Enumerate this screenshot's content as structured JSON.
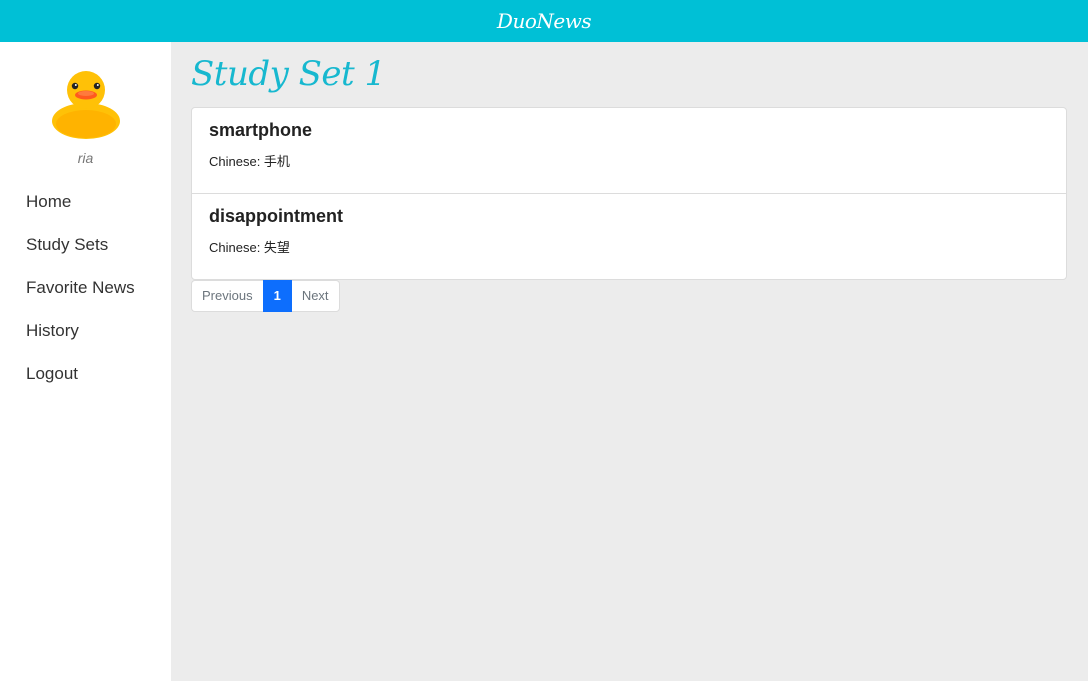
{
  "app": {
    "brand": "DuoNews"
  },
  "sidebar": {
    "username": "ria",
    "avatar_icon": "rubber-duck-icon",
    "items": [
      {
        "label": "Home"
      },
      {
        "label": "Study Sets"
      },
      {
        "label": "Favorite News"
      },
      {
        "label": "History"
      },
      {
        "label": "Logout"
      }
    ]
  },
  "main": {
    "title": "Study Set 1",
    "cards": [
      {
        "word": "smartphone",
        "translation": "Chinese: 手机"
      },
      {
        "word": "disappointment",
        "translation": "Chinese: 失望"
      }
    ],
    "pagination": {
      "previous_label": "Previous",
      "current_page": "1",
      "next_label": "Next"
    }
  },
  "colors": {
    "accent": "#00c0d6",
    "title": "#17b8cf",
    "active_page": "#0d6efd"
  }
}
